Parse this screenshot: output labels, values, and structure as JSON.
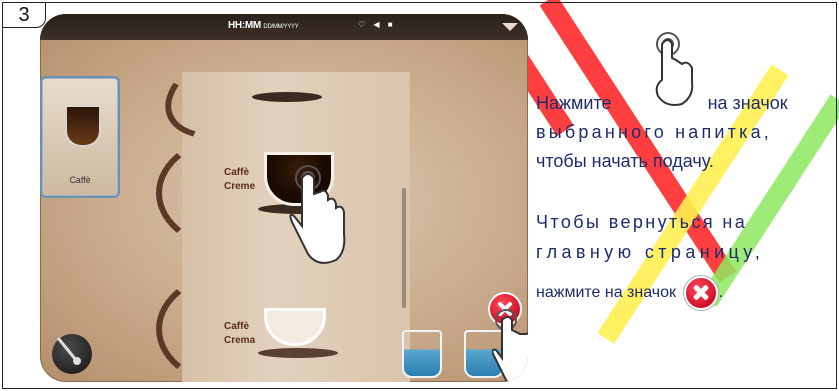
{
  "step_number": "3",
  "device_screen": {
    "status_time": "HH:MM",
    "status_date": "DD/MM/YYYY",
    "status_icons": "♡ ◀ ■",
    "selected_drink_label": "Caffè",
    "drinks": [
      {
        "line1": "Caffè",
        "line2": "Creme"
      },
      {
        "line1": "Caffè",
        "line2": "Crema"
      }
    ]
  },
  "instructions": {
    "line1_prefix": "Нажмите",
    "line1_suffix": "на значок",
    "line2": "выбранного напитка,",
    "line3": "чтобы начать подачу.",
    "line4": "Чтобы вернуться на",
    "line5": "главную страницу,",
    "line6_prefix": "нажмите на значок",
    "line6_suffix": "."
  },
  "colors": {
    "text": "#1f2c6b",
    "close_red": "#e0172d",
    "stripe_red": "#ff2a2a",
    "stripe_yellow": "#fff050",
    "stripe_green": "#8ee860"
  },
  "icons": [
    "hand-pointer-icon",
    "close-icon",
    "milk-jug-icon",
    "steam-wand-icon",
    "menu-arrow-icon"
  ]
}
